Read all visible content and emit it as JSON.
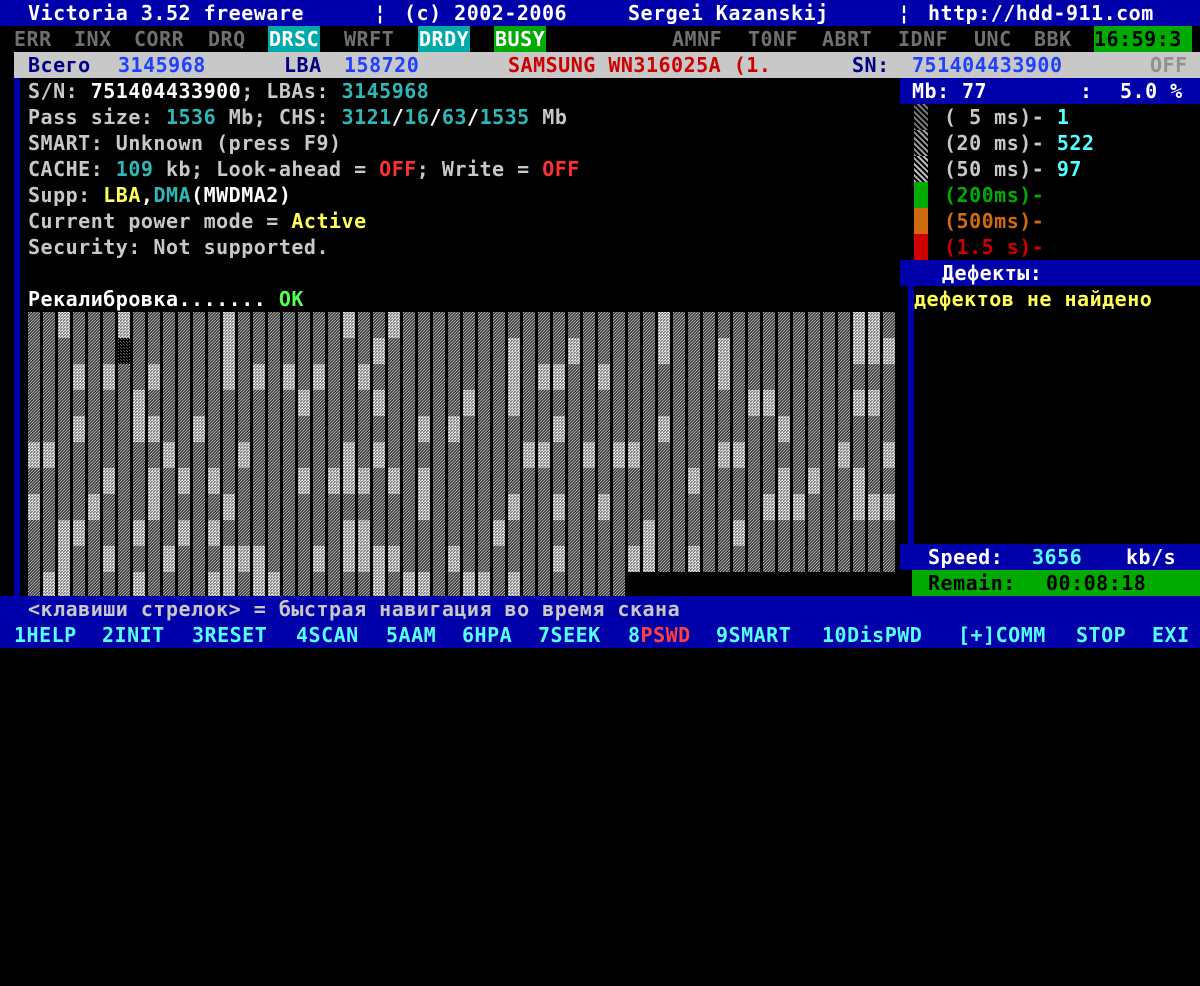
{
  "title": {
    "app": "Victoria 3.52 freeware",
    "sep1": "¦",
    "copyright": "(c) 2002-2006",
    "author": "Sergei Kazanskij",
    "sep2": "¦",
    "url": "http://hdd-911.com"
  },
  "flags": {
    "items": [
      "ERR",
      "INX",
      "CORR",
      "DRQ",
      "DRSC",
      "WRFT",
      "DRDY",
      "BUSY",
      "AMNF",
      "T0NF",
      "ABRT",
      "IDNF",
      "UNC",
      "BBK"
    ],
    "active": [
      "DRSC",
      "DRDY",
      "BUSY"
    ],
    "clock": "16:59:3"
  },
  "infobar": {
    "total_label": "Всего",
    "total_value": "3145968",
    "lba_label": "LBA",
    "lba_value": "158720",
    "model": "SAMSUNG WN316025A (1.",
    "sn_label": "SN:",
    "sn_value": "751404433900",
    "off": "OFF"
  },
  "info": {
    "sn_label": "S/N:",
    "sn_value": "751404433900",
    "lbas_label": "; LBAs:",
    "lbas_value": "3145968",
    "pass_label": "Pass size:",
    "pass_value": "1536",
    "pass_unit": "Mb; CHS:",
    "chs_c": "3121",
    "chs_h": "16",
    "chs_s": "63",
    "chs_mb": "1535",
    "chs_unit": "Mb",
    "smart": "SMART: Unknown (press F9)",
    "cache_label": "CACHE:",
    "cache_value": "109",
    "cache_unit": "kb; Look-ahead =",
    "lookahead": "OFF",
    "write_label": "; Write =",
    "write": "OFF",
    "supp_label": "Supp:",
    "supp_lba": "LBA",
    "supp_comma": ",",
    "supp_dma": "DMA",
    "supp_mode": "(MWDMA2)",
    "power_label": "Current power mode =",
    "power_value": "Active",
    "security": "Security: Not supported.",
    "recal_label": "Рекалибровка.......",
    "recal_value": "OK"
  },
  "stats": {
    "mb_label": "Mb:",
    "mb_value": "77",
    "colon": ":",
    "percent": "5.0 %",
    "rows": [
      {
        "label": "( 5 ms)-",
        "value": "1",
        "color": "#c8c8c8"
      },
      {
        "label": "(20 ms)-",
        "value": "522",
        "color": "#c8c8c8"
      },
      {
        "label": "(50 ms)-",
        "value": "97",
        "color": "#c8c8c8"
      },
      {
        "label": "(200ms)-",
        "value": "",
        "color": "#00aa00"
      },
      {
        "label": "(500ms)-",
        "value": "",
        "color": "#d06a10"
      },
      {
        "label": "(1.5 s)-",
        "value": "",
        "color": "#cc0000"
      }
    ]
  },
  "defects": {
    "header": "Дефекты:",
    "text": "дефектов не найдено"
  },
  "speed": {
    "label": "Speed:",
    "value": "3656",
    "unit": "kb/s"
  },
  "remain": {
    "label": "Remain:",
    "value": "00:08:18"
  },
  "hint": "<клавиши стрелок> = быстрая навигация во время скана",
  "fkeys": [
    {
      "num": "1",
      "label": "HELP"
    },
    {
      "num": "2",
      "label": "INIT"
    },
    {
      "num": "3",
      "label": "RESET"
    },
    {
      "num": "4",
      "label": "SCAN"
    },
    {
      "num": "5",
      "label": "AAM"
    },
    {
      "num": "6",
      "label": "HPA"
    },
    {
      "num": "7",
      "label": "SEEK"
    },
    {
      "num": "8",
      "label": "PSWD"
    },
    {
      "num": "9",
      "label": "SMART"
    },
    {
      "num": "10",
      "label": "DisPWD"
    },
    {
      "num": "",
      "label": "[+]COMM"
    },
    {
      "num": "",
      "label": "STOP"
    },
    {
      "num": "",
      "label": "EXI"
    }
  ]
}
